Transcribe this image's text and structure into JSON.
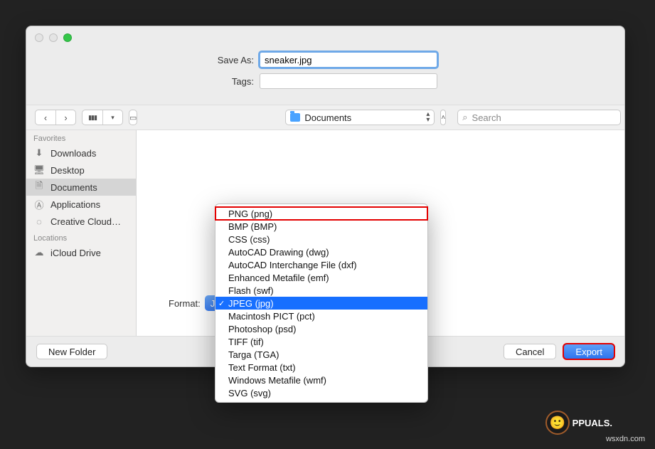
{
  "saveAs": {
    "label": "Save As:",
    "filename_selected": "sneaker",
    "filename_ext": ".jpg"
  },
  "tags": {
    "label": "Tags:",
    "value": ""
  },
  "toolbar": {
    "location": "Documents",
    "search_placeholder": "Search"
  },
  "sidebar": {
    "favorites_label": "Favorites",
    "items": [
      {
        "label": "Downloads"
      },
      {
        "label": "Desktop"
      },
      {
        "label": "Documents"
      },
      {
        "label": "Applications"
      },
      {
        "label": "Creative Cloud…"
      }
    ],
    "locations_label": "Locations",
    "locations": [
      {
        "label": "iCloud Drive"
      }
    ]
  },
  "format": {
    "label": "Format:",
    "selected": "JPEG (jpg)"
  },
  "dropdown": {
    "items": [
      "PNG (png)",
      "BMP (BMP)",
      "CSS (css)",
      "AutoCAD Drawing (dwg)",
      "AutoCAD Interchange File (dxf)",
      "Enhanced Metafile (emf)",
      "Flash (swf)",
      "JPEG (jpg)",
      "Macintosh PICT (pct)",
      "Photoshop (psd)",
      "TIFF (tif)",
      "Targa (TGA)",
      "Text Format (txt)",
      "Windows Metafile (wmf)",
      "SVG (svg)"
    ],
    "selected_index": 7,
    "highlight_index": 0
  },
  "footer": {
    "new_folder": "New Folder",
    "cancel": "Cancel",
    "export": "Export"
  },
  "watermark": "wsxdn.com",
  "brand": "PPUALS."
}
